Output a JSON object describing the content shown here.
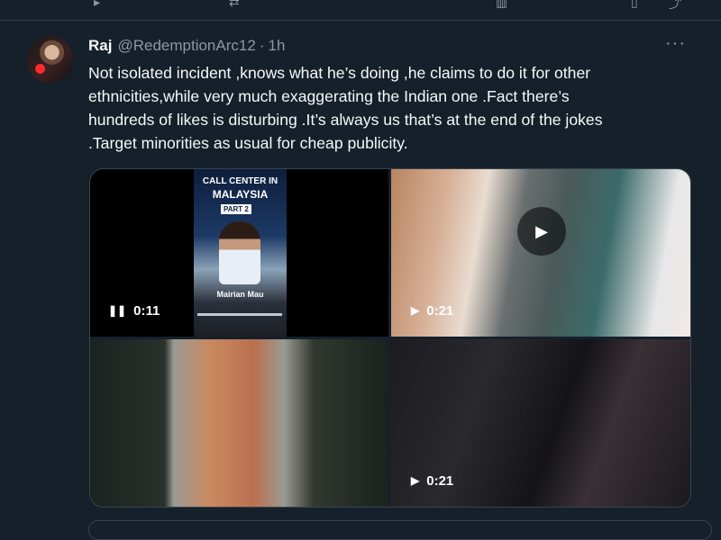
{
  "tweet": {
    "author_name": "Raj",
    "handle": "@RedemptionArc12",
    "separator": "·",
    "time": "1h",
    "more_icon": "···",
    "text": "Not isolated incident ,knows what he’s doing ,he claims to do it for other\nethnicities,while very much exaggerating the Indian one .Fact there’s\nhundreds of likes is disturbing .It’s always us that’s at the end of the jokes\n.Target minorities as usual for cheap publicity."
  },
  "media": {
    "items": [
      {
        "duration": "0:11",
        "state_icon": "pause-icon",
        "poster": {
          "line1": "CALL CENTER IN",
          "line2": "MALAYSIA",
          "line3": "PART 2",
          "caption": "Mairian Mau"
        }
      },
      {
        "duration": "0:21",
        "state_icon": "play-icon"
      },
      {
        "duration": "",
        "state_icon": ""
      },
      {
        "duration": "0:21",
        "state_icon": "play-icon"
      }
    ]
  },
  "colors": {
    "background": "#15202b",
    "border": "#38444d",
    "secondary_text": "#8b98a5"
  }
}
